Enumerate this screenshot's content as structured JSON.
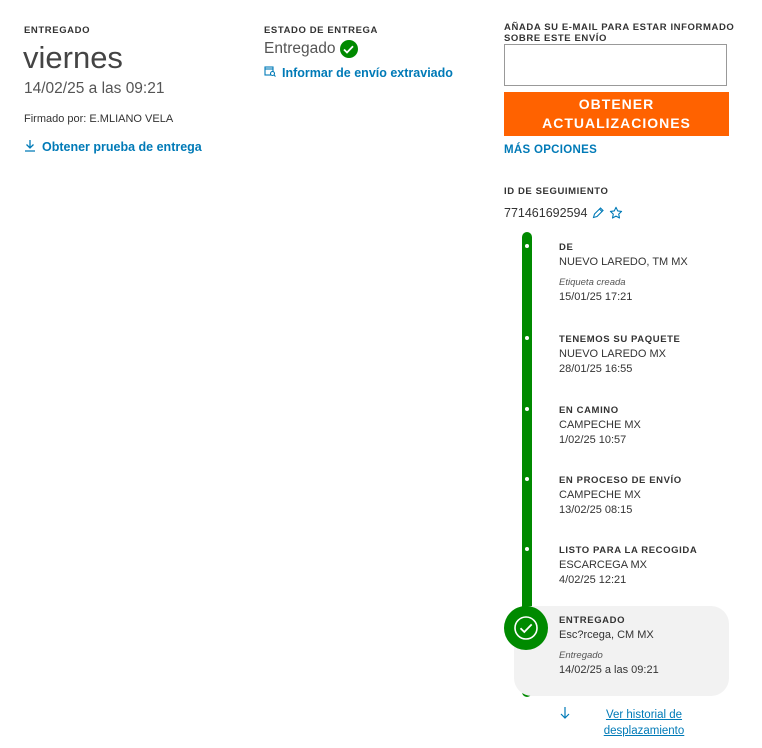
{
  "delivery": {
    "label": "ENTREGADO",
    "day": "viernes",
    "datetime": "14/02/25 a las 09:21",
    "signed_by": "Firmado por: E.MLIANO VELA",
    "proof_link": "Obtener prueba de entrega"
  },
  "status": {
    "label": "ESTADO DE ENTREGA",
    "value": "Entregado",
    "lost_link": "Informar de envío extraviado"
  },
  "updates": {
    "email_label": "AÑADA SU E-MAIL PARA ESTAR INFORMADO SOBRE ESTE ENVÍO",
    "email_value": "",
    "button_line1": "OBTENER",
    "button_line2": "ACTUALIZACIONES",
    "more_options": "MÁS OPCIONES"
  },
  "tracking": {
    "label": "ID DE SEGUIMIENTO",
    "number": "771461692594"
  },
  "events": [
    {
      "title": "DE",
      "location": "NUEVO LAREDO, TM MX",
      "sub": "Etiqueta creada",
      "datetime": "15/01/25 17:21"
    },
    {
      "title": "TENEMOS SU PAQUETE",
      "location": "NUEVO LAREDO MX",
      "datetime": "28/01/25 16:55"
    },
    {
      "title": "EN CAMINO",
      "location": "CAMPECHE MX",
      "datetime": "1/02/25 10:57"
    },
    {
      "title": "EN PROCESO DE ENVÍO",
      "location": "CAMPECHE MX",
      "datetime": "13/02/25 08:15"
    },
    {
      "title": "LISTO PARA LA RECOGIDA",
      "location": "ESCARCEGA MX",
      "datetime": "4/02/25 12:21"
    },
    {
      "title": "ENTREGADO",
      "location": "Esc?rcega, CM MX",
      "sub": "Entregado",
      "datetime": "14/02/25 a las 09:21"
    }
  ],
  "history_link": "Ver historial de desplazamiento",
  "colors": {
    "accent": "#007ab7",
    "success": "#008a00",
    "cta": "#ff6200"
  },
  "icons": [
    "download-icon",
    "lost-package-icon",
    "check-circle-icon",
    "pencil-icon",
    "star-icon",
    "arrow-down-icon"
  ]
}
